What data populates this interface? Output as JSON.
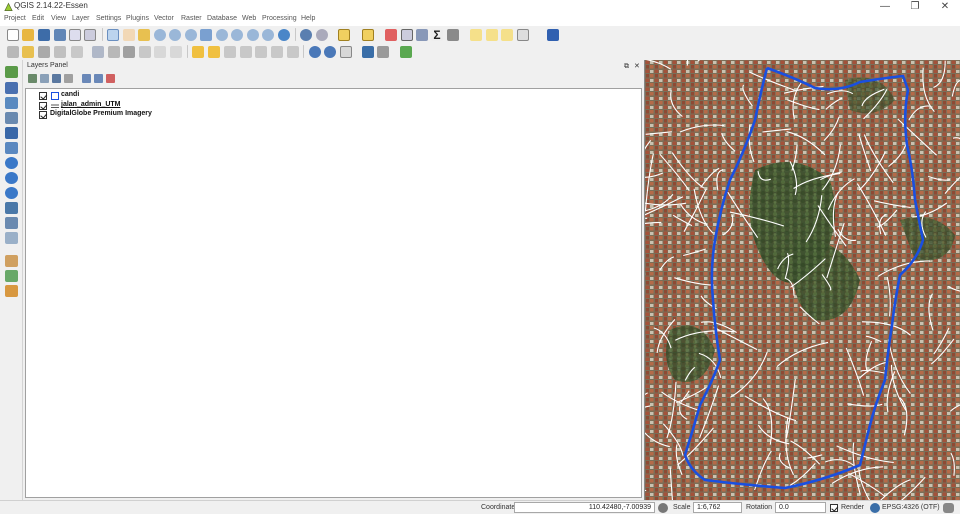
{
  "window": {
    "title": "QGIS 2.14.22-Essen",
    "min": "—",
    "max": "❐",
    "close": "✕"
  },
  "menu": [
    "Project",
    "Edit",
    "View",
    "Layer",
    "Settings",
    "Plugins",
    "Vector",
    "Raster",
    "Database",
    "Web",
    "Processing",
    "Help"
  ],
  "layers_panel": {
    "title": "Layers Panel",
    "float_btn": "⧉",
    "close_btn": "✕",
    "layers": [
      {
        "name": "candi",
        "checked": true,
        "symbol": "polygon"
      },
      {
        "name": "jalan_admin_UTM",
        "checked": true,
        "symbol": "line"
      },
      {
        "name": "DigitalGlobe Premium Imagery",
        "checked": true,
        "symbol": "none"
      }
    ]
  },
  "statusbar": {
    "coordinate_label": "Coordinate",
    "coordinate_value": "110.42480,-7.00939",
    "scale_label": "Scale",
    "scale_value": "1:6,762",
    "rotation_label": "Rotation",
    "rotation_value": "0.0",
    "render_label": "Render",
    "crs": "EPSG:4326 (OTF)"
  },
  "colors": {
    "route_line": "#1a4fe0",
    "road_lines": "#ffffff",
    "imagery_base": "#6b6a52"
  }
}
